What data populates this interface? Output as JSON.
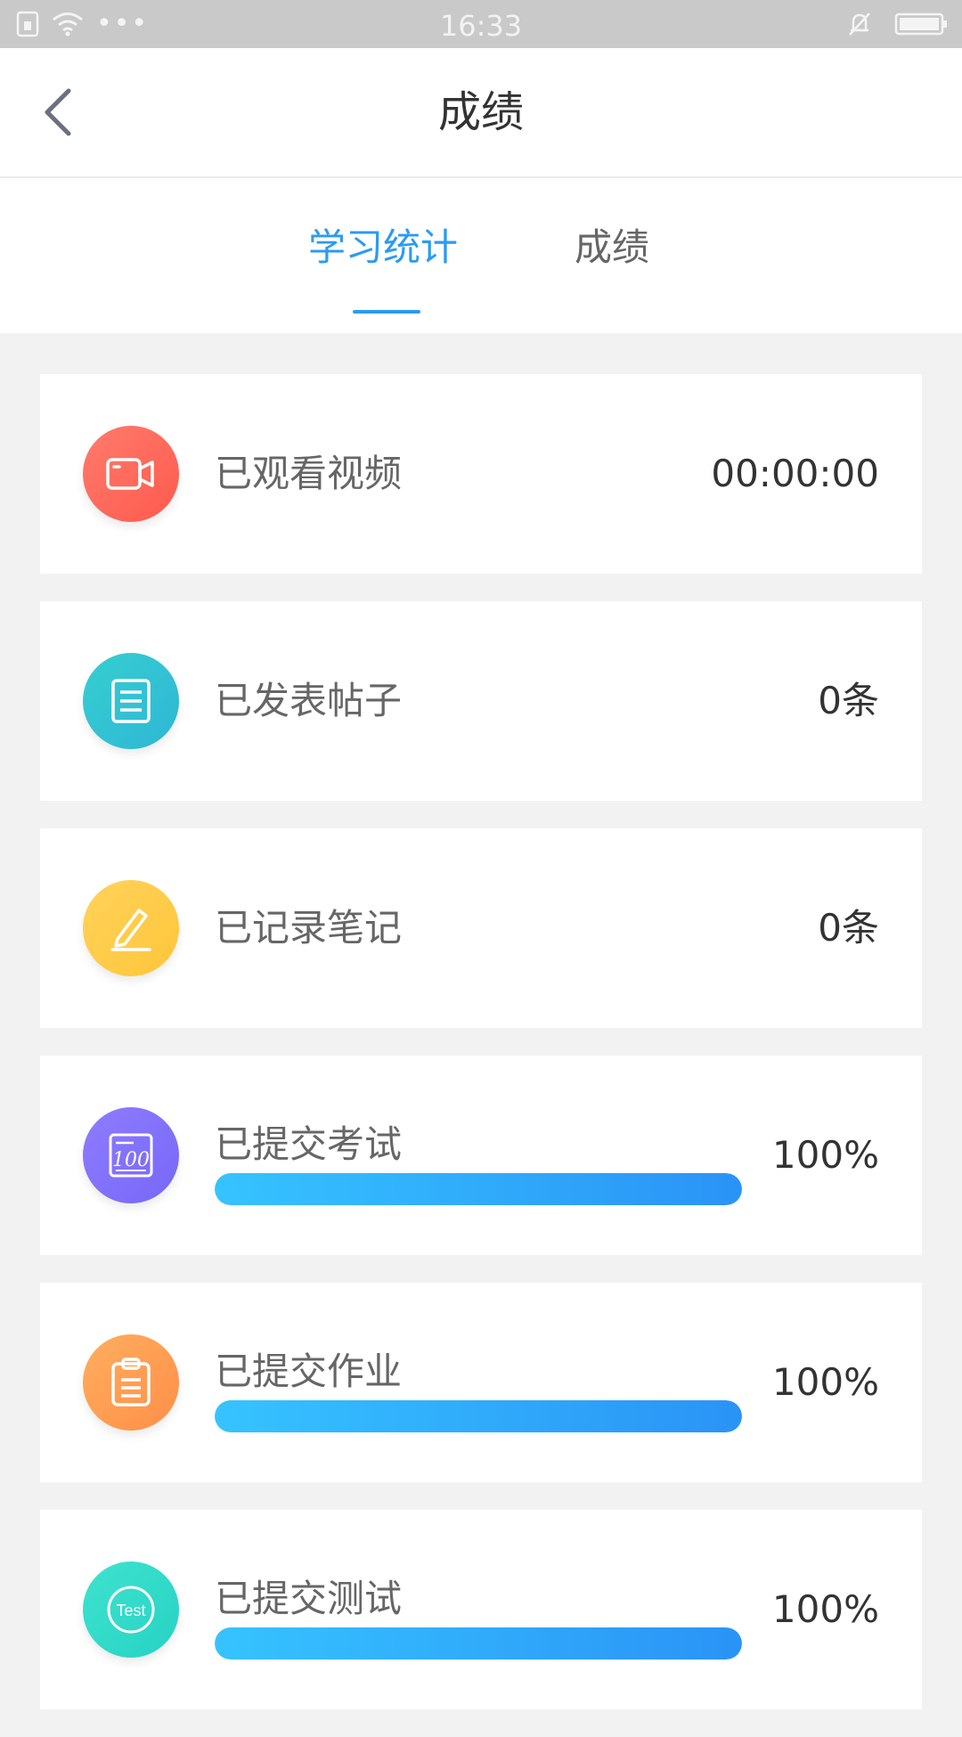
{
  "status_bar": {
    "time": "16:33",
    "left_icons": [
      "sim-icon",
      "wifi-icon",
      "more-icon"
    ],
    "right_icons": [
      "bell-off-icon",
      "battery-icon"
    ]
  },
  "header": {
    "title": "成绩",
    "back_icon": "back-arrow-icon"
  },
  "tabs": [
    {
      "label": "学习统计",
      "active": true
    },
    {
      "label": "成绩",
      "active": false
    }
  ],
  "colors": {
    "accent": "#2b9bf0",
    "progress_start": "#36c3ff",
    "progress_end": "#2a93f6"
  },
  "stats": [
    {
      "icon": "video-camera-icon",
      "label": "已观看视频",
      "value": "00:00:00"
    },
    {
      "icon": "document-icon",
      "label": "已发表帖子",
      "value": "0条"
    },
    {
      "icon": "pencil-icon",
      "label": "已记录笔记",
      "value": "0条"
    },
    {
      "icon": "exam-score-icon",
      "label": "已提交考试",
      "value": "100%",
      "progress": 100
    },
    {
      "icon": "clipboard-icon",
      "label": "已提交作业",
      "value": "100%",
      "progress": 100
    },
    {
      "icon": "test-badge-icon",
      "label": "已提交测试",
      "value": "100%",
      "progress": 100,
      "icon_text": "Test"
    }
  ]
}
